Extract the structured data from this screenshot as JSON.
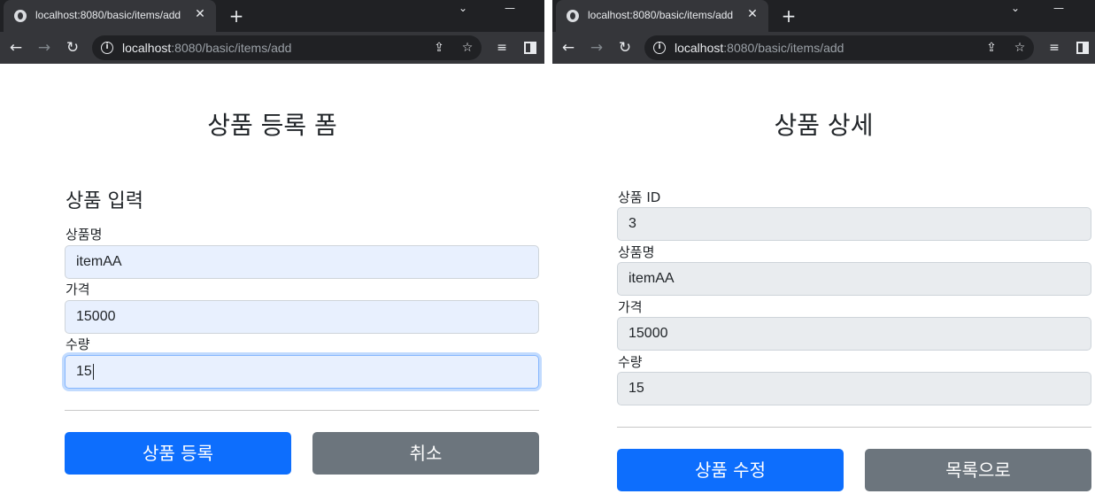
{
  "left_window": {
    "tab_title": "localhost:8080/basic/items/add",
    "url_host": "localhost",
    "url_path": ":8080/basic/items/add",
    "page_title": "상품 등록 폼",
    "section_title": "상품 입력",
    "fields": [
      {
        "label": "상품명",
        "value": "itemAA"
      },
      {
        "label": "가격",
        "value": "15000"
      },
      {
        "label": "수량",
        "value": "15"
      }
    ],
    "submit_label": "상품 등록",
    "cancel_label": "취소"
  },
  "right_window": {
    "tab_title": "localhost:8080/basic/items/add",
    "url_host": "localhost",
    "url_path": ":8080/basic/items/add",
    "page_title": "상품 상세",
    "fields": [
      {
        "label": "상품 ID",
        "value": "3"
      },
      {
        "label": "상품명",
        "value": "itemAA"
      },
      {
        "label": "가격",
        "value": "15000"
      },
      {
        "label": "수량",
        "value": "15"
      }
    ],
    "edit_label": "상품 수정",
    "list_label": "목록으로"
  },
  "chrome": {
    "close_glyph": "✕",
    "new_tab_glyph": "+",
    "back_glyph": "←",
    "forward_glyph": "→",
    "reload_glyph": "↻",
    "minimize_glyph": "—",
    "dropdown_glyph": "⌄"
  },
  "colors": {
    "primary": "#0d6efd",
    "secondary": "#6c757d",
    "autofill": "#e8f0fe",
    "readonly": "#e9ecef"
  }
}
